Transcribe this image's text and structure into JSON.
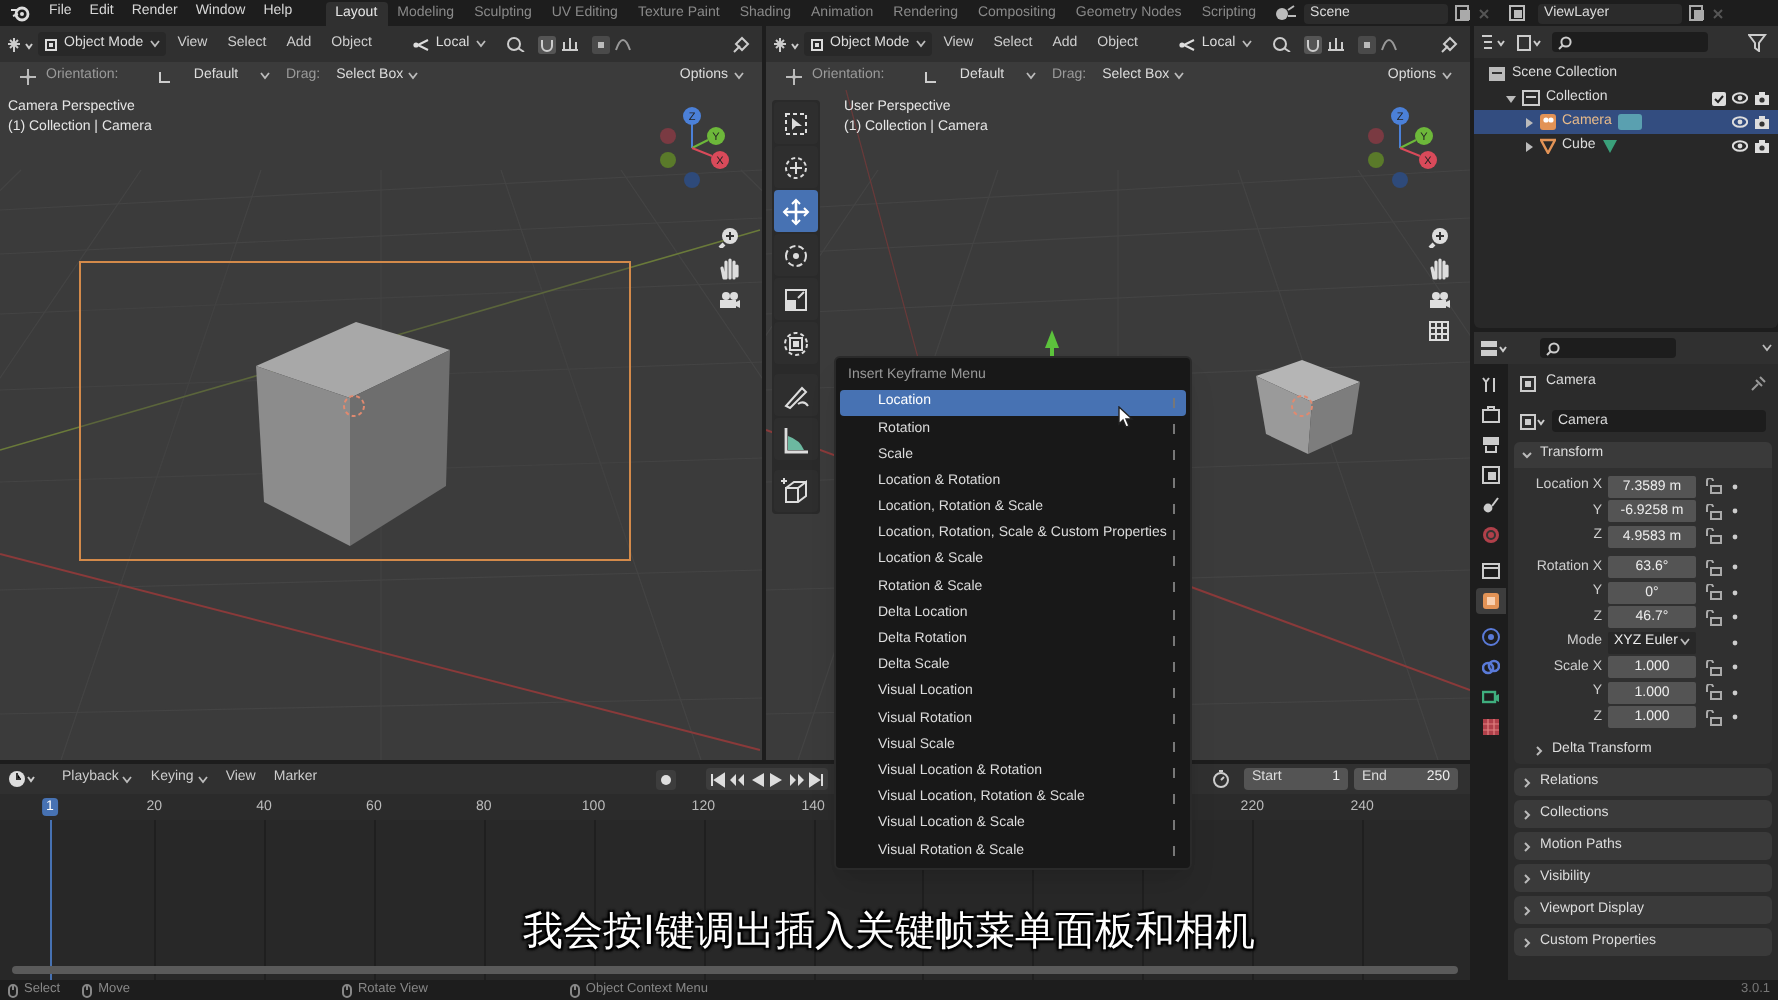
{
  "topbar": {
    "menus": [
      "File",
      "Edit",
      "Render",
      "Window",
      "Help"
    ],
    "workspaces": [
      {
        "label": "Layout",
        "selected": true
      },
      {
        "label": "Modeling",
        "selected": false
      },
      {
        "label": "Sculpting",
        "selected": false
      },
      {
        "label": "UV Editing",
        "selected": false
      },
      {
        "label": "Texture Paint",
        "selected": false
      },
      {
        "label": "Shading",
        "selected": false
      },
      {
        "label": "Animation",
        "selected": false
      },
      {
        "label": "Rendering",
        "selected": false
      },
      {
        "label": "Compositing",
        "selected": false
      },
      {
        "label": "Geometry Nodes",
        "selected": false
      },
      {
        "label": "Scripting",
        "selected": false
      }
    ],
    "scene": "Scene",
    "view_layer": "ViewLayer"
  },
  "viewports": [
    {
      "kind": "camera",
      "mode": "Object Mode",
      "menus": [
        "View",
        "Select",
        "Add",
        "Object"
      ],
      "pivot": "Local",
      "orientation_label": "Orientation:",
      "orientation": "Default",
      "drag_label": "Drag:",
      "drag": "Select Box",
      "options": "Options",
      "perspective": "Camera Perspective",
      "context": "(1) Collection | Camera",
      "gizmo": [
        "Z",
        "Y",
        "X"
      ]
    },
    {
      "kind": "user",
      "mode": "Object Mode",
      "menus": [
        "View",
        "Select",
        "Add",
        "Object"
      ],
      "pivot": "Local",
      "orientation_label": "Orientation:",
      "orientation": "Default",
      "drag_label": "Drag:",
      "drag": "Select Box",
      "options": "Options",
      "perspective": "User Perspective",
      "context": "(1) Collection | Camera",
      "gizmo": [
        "Z",
        "Y",
        "X"
      ]
    }
  ],
  "tools": [
    {
      "selected": false
    },
    {
      "selected": false
    },
    {
      "selected": true
    },
    {
      "selected": false
    },
    {
      "selected": false
    },
    {
      "selected": false
    },
    {
      "selected": false
    },
    {
      "selected": false
    },
    {
      "selected": false
    }
  ],
  "keyframe_menu": {
    "title": "Insert Keyframe Menu",
    "items": [
      {
        "label": "Location",
        "selected": true
      },
      {
        "label": "Rotation",
        "selected": false
      },
      {
        "label": "Scale",
        "selected": false
      },
      {
        "label": "Location & Rotation",
        "selected": false
      },
      {
        "label": "Location, Rotation & Scale",
        "selected": false
      },
      {
        "label": "Location, Rotation, Scale & Custom Properties",
        "selected": false
      },
      {
        "label": "Location & Scale",
        "selected": false
      },
      {
        "label": "Rotation & Scale",
        "selected": false
      },
      {
        "label": "Delta Location",
        "selected": false
      },
      {
        "label": "Delta Rotation",
        "selected": false
      },
      {
        "label": "Delta Scale",
        "selected": false
      },
      {
        "label": "Visual Location",
        "selected": false
      },
      {
        "label": "Visual Rotation",
        "selected": false
      },
      {
        "label": "Visual Scale",
        "selected": false
      },
      {
        "label": "Visual Location & Rotation",
        "selected": false
      },
      {
        "label": "Visual Location, Rotation & Scale",
        "selected": false
      },
      {
        "label": "Visual Location & Scale",
        "selected": false
      },
      {
        "label": "Visual Rotation & Scale",
        "selected": false
      }
    ]
  },
  "outliner": {
    "items": [
      {
        "label": "Scene Collection",
        "kind": "scene",
        "children": [
          {
            "label": "Collection",
            "kind": "collection",
            "expanded": true,
            "checked": true,
            "selected": false,
            "children": [
              {
                "label": "Camera",
                "kind": "camera",
                "expanded": false,
                "selected": true
              },
              {
                "label": "Cube",
                "kind": "mesh",
                "expanded": false,
                "selected": false
              }
            ]
          }
        ]
      }
    ]
  },
  "properties": {
    "tabs": [
      {
        "selected": false
      },
      {
        "selected": false
      },
      {
        "selected": false
      },
      {
        "selected": false
      },
      {
        "selected": false
      },
      {
        "selected": false
      },
      {
        "selected": false
      },
      {
        "selected": true
      },
      {
        "selected": false
      },
      {
        "selected": false
      },
      {
        "selected": false
      },
      {
        "selected": false
      }
    ],
    "object": "Camera",
    "name_field": "Camera",
    "transform": {
      "title": "Transform",
      "expanded": true,
      "rows": [
        {
          "kind": "number",
          "label": "Location X",
          "value": "7.3589 m"
        },
        {
          "kind": "number",
          "label": "Y",
          "value": "-6.9258 m"
        },
        {
          "kind": "number",
          "label": "Z",
          "value": "4.9583 m"
        },
        {
          "kind": "gap"
        },
        {
          "kind": "number",
          "label": "Rotation X",
          "value": "63.6°"
        },
        {
          "kind": "number",
          "label": "Y",
          "value": "0°"
        },
        {
          "kind": "number",
          "label": "Z",
          "value": "46.7°"
        },
        {
          "kind": "dropdown",
          "label": "Mode",
          "value": "XYZ Euler"
        },
        {
          "kind": "number",
          "label": "Scale X",
          "value": "1.000"
        },
        {
          "kind": "number",
          "label": "Y",
          "value": "1.000"
        },
        {
          "kind": "number",
          "label": "Z",
          "value": "1.000"
        }
      ],
      "subpanel": {
        "label": "Delta Transform",
        "expanded": false
      }
    },
    "panels": [
      {
        "label": "Relations",
        "expanded": false
      },
      {
        "label": "Collections",
        "expanded": false
      },
      {
        "label": "Motion Paths",
        "expanded": false
      },
      {
        "label": "Visibility",
        "expanded": false
      },
      {
        "label": "Viewport Display",
        "expanded": false
      },
      {
        "label": "Custom Properties",
        "expanded": false
      }
    ]
  },
  "timeline": {
    "menus": [
      "Playback",
      "Keying",
      "View",
      "Marker"
    ],
    "start_label": "Start",
    "start": "1",
    "end_label": "End",
    "end": "250",
    "frames": [
      {
        "label": "1",
        "selected": true
      },
      {
        "label": "20",
        "selected": false
      },
      {
        "label": "40",
        "selected": false
      },
      {
        "label": "60",
        "selected": false
      },
      {
        "label": "80",
        "selected": false
      },
      {
        "label": "100",
        "selected": false
      },
      {
        "label": "120",
        "selected": false
      },
      {
        "label": "140",
        "selected": false
      },
      {
        "label": "220",
        "selected": false
      },
      {
        "label": "240",
        "selected": false
      }
    ]
  },
  "status_bar": {
    "hints": [
      "Select",
      "Move",
      "Rotate View",
      "Object Context Menu"
    ],
    "version": "3.0.1"
  },
  "subtitle": "我会按I键调出插入关键帧菜单面板和相机"
}
